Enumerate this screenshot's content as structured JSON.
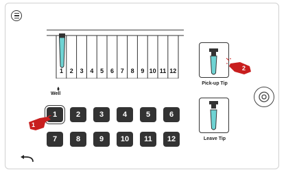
{
  "rack": {
    "slots": [
      "1",
      "2",
      "3",
      "4",
      "5",
      "6",
      "7",
      "8",
      "9",
      "10",
      "11",
      "12"
    ],
    "well_label": "Well"
  },
  "keypad": {
    "buttons": [
      "1",
      "2",
      "3",
      "4",
      "5",
      "6",
      "7",
      "8",
      "9",
      "10",
      "11",
      "12"
    ],
    "selected": "1"
  },
  "tips": {
    "pickup_label": "Pick-up Tip",
    "leave_label": "Leave Tip"
  },
  "steps": {
    "step1": "1",
    "step2": "2"
  },
  "icons": {
    "menu": "menu-icon",
    "back": "back-arrow-icon",
    "side": "rotate-icon",
    "hand": "pointing-hand-icon"
  },
  "colors": {
    "tip_fill": "#6fd3d3",
    "badge": "#c81e1e",
    "key_bg": "#333333"
  }
}
